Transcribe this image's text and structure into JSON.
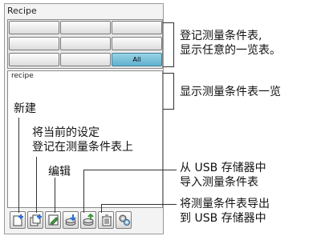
{
  "panel": {
    "title": "Recipe"
  },
  "grid": {
    "cells": [
      "",
      "",
      "",
      "",
      "",
      "",
      "",
      "",
      "All"
    ],
    "selected_index": 8
  },
  "list": {
    "header": "recipe"
  },
  "toolbar": {
    "buttons": [
      {
        "name": "new-icon"
      },
      {
        "name": "register-current-settings-icon"
      },
      {
        "name": "edit-icon"
      },
      {
        "name": "import-usb-icon"
      },
      {
        "name": "export-usb-icon"
      },
      {
        "name": "delete-icon"
      },
      {
        "name": "settings-icon"
      }
    ]
  },
  "annotations": {
    "grid": [
      "登记测量条件表,",
      "显示任意的一览表。"
    ],
    "list": "显示测量条件表一览",
    "new": "新建",
    "register": [
      "将当前的设定",
      "登记在测量条件表上"
    ],
    "edit": "编辑",
    "import": [
      "从 USB 存储器中",
      "导入测量条件表"
    ],
    "export": [
      "将测量条件表导出",
      "到 USB 存储器中"
    ]
  },
  "colors": {
    "selected_cell": "#5fb0cf"
  }
}
